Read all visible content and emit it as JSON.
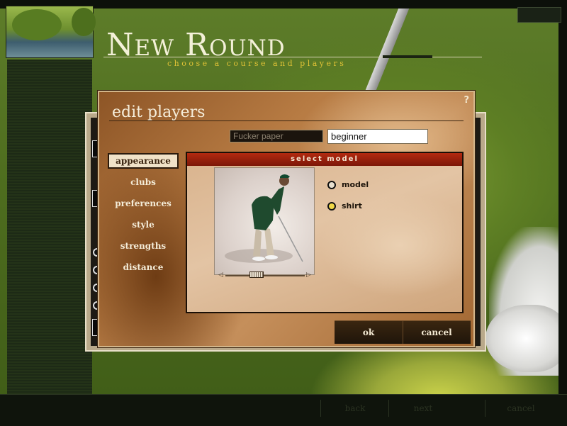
{
  "app": {
    "title": "New Round",
    "subtitle": "choose a course and players"
  },
  "dialog": {
    "title": "edit players",
    "help_label": "?",
    "player_name": {
      "value": "Fucker paper"
    },
    "skill_level": {
      "value": "beginner"
    },
    "menu": [
      {
        "label": "appearance",
        "active": true
      },
      {
        "label": "clubs",
        "active": false
      },
      {
        "label": "preferences",
        "active": false
      },
      {
        "label": "style",
        "active": false
      },
      {
        "label": "strengths",
        "active": false
      },
      {
        "label": "distance",
        "active": false
      }
    ],
    "panel": {
      "header": "select model",
      "options": [
        {
          "label": "model",
          "selected": false
        },
        {
          "label": "shirt",
          "selected": true
        }
      ],
      "slider_position": 0.35
    },
    "buttons": {
      "ok": "ok",
      "cancel": "cancel"
    }
  },
  "bottom_nav": {
    "back": "back",
    "next": "next",
    "cancel": "cancel"
  },
  "colors": {
    "accent": "#b32a10",
    "dialog": "#b77b43",
    "highlight": "#f0d848"
  }
}
